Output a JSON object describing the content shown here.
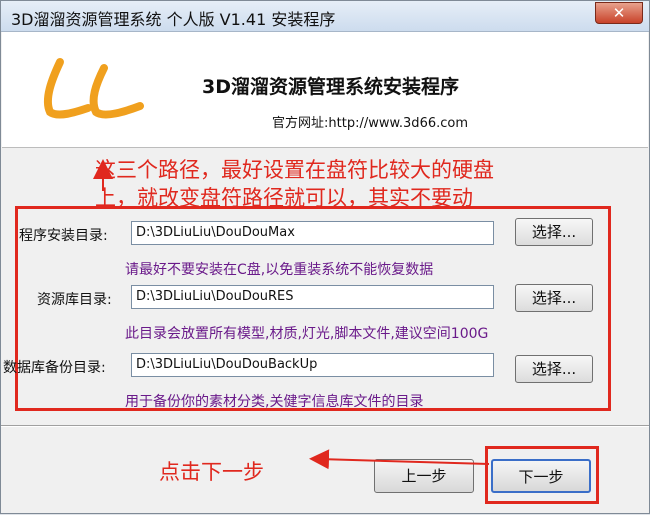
{
  "window": {
    "title": "3D溜溜资源管理系统 个人版 V1.41 安装程序",
    "close_glyph": "✕"
  },
  "header": {
    "logo_text": "LL",
    "heading": "3D溜溜资源管理系统安装程序",
    "website": "官方网址:http://www.3d66.com"
  },
  "annotations": {
    "top_line1": "这三个路径，最好设置在盘符比较大的硬盘",
    "top_line2": "上，就改变盘符路径就可以，其实不要动",
    "click_next": "点击下一步"
  },
  "fields": [
    {
      "label": "程序安装目录:",
      "value": "D:\\3DLiuLiu\\DouDouMax",
      "button": "选择...",
      "hint": "请最好不要安装在C盘,以免重装系统不能恢复数据"
    },
    {
      "label": "资源库目录:",
      "value": "D:\\3DLiuLiu\\DouDouRES",
      "button": "选择...",
      "hint": "此目录会放置所有模型,材质,灯光,脚本文件,建议空间100G"
    },
    {
      "label": "数据库备份目录:",
      "value": "D:\\3DLiuLiu\\DouDouBackUp",
      "button": "选择...",
      "hint": "用于备份你的素材分类,关健字信息库文件的目录"
    }
  ],
  "nav": {
    "back": "上一步",
    "next": "下一步"
  },
  "colors": {
    "annotation_red": "#e0281e",
    "hint_purple": "#6a1a8a",
    "logo_orange": "#f0a01e"
  }
}
